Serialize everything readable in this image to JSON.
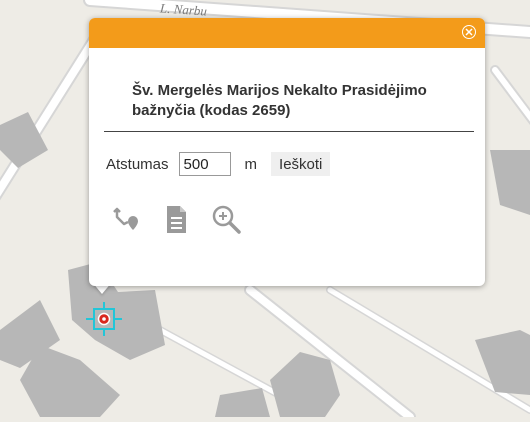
{
  "map": {
    "street_label": "L. Narbu",
    "colors": {
      "background": "#eeece6",
      "building": "#b7b7b7",
      "road_border": "#d6d6d6",
      "road": "#ffffff",
      "marker": "#22c6d8"
    },
    "marker": {
      "icon": "location-marker-icon",
      "color": "#d8281e"
    }
  },
  "popup": {
    "header_color": "#f39b1a",
    "close_icon": "close-circle-icon",
    "title": "Šv. Mergelės Marijos Nekalto Prasidėjimo bažnyčia (kodas 2659)",
    "distance": {
      "label": "Atstumas",
      "value": "500",
      "unit": "m",
      "search_button": "Ieškoti"
    },
    "tools": [
      {
        "icon": "route-directions-icon"
      },
      {
        "icon": "document-icon"
      },
      {
        "icon": "zoom-in-icon"
      }
    ]
  }
}
